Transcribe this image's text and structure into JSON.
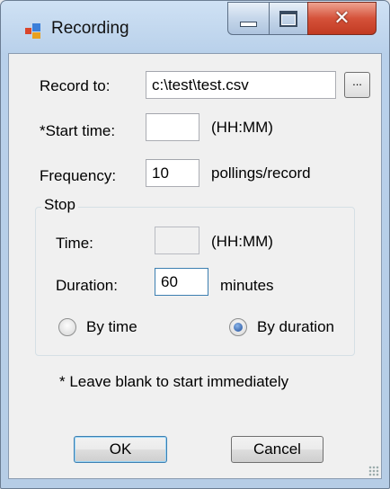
{
  "window": {
    "title": "Recording",
    "controls": {
      "minimize": "minimize",
      "maximize": "maximize",
      "close": "close"
    }
  },
  "form": {
    "record_to": {
      "label": "Record to:",
      "value": "c:\\test\\test.csv",
      "browse_label": "..."
    },
    "start_time": {
      "label": "*Start time:",
      "value": "",
      "hint": "(HH:MM)"
    },
    "frequency": {
      "label": "Frequency:",
      "value": "10",
      "unit": "pollings/record"
    }
  },
  "stop": {
    "title": "Stop",
    "time": {
      "label": "Time:",
      "value": "",
      "hint": "(HH:MM)"
    },
    "duration": {
      "label": "Duration:",
      "value": "60",
      "unit": "minutes"
    },
    "by_time": {
      "label": "By time",
      "checked": false
    },
    "by_duration": {
      "label": "By duration",
      "checked": true
    }
  },
  "note": "* Leave blank to start immediately",
  "buttons": {
    "ok": "OK",
    "cancel": "Cancel"
  },
  "colors": {
    "accent": "#3c7fb1",
    "close": "#c13a22",
    "frame": "#b8d0ea"
  }
}
